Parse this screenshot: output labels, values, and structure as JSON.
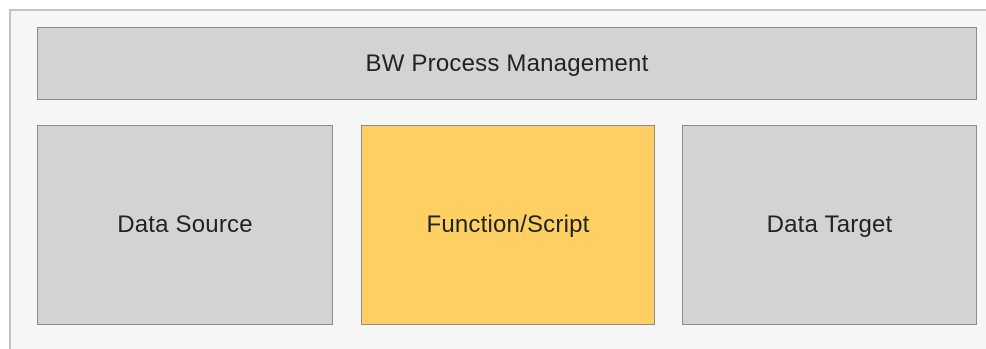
{
  "diagram": {
    "header": {
      "label": "BW Process Management"
    },
    "components": [
      {
        "label": "Data Source",
        "color": "#d3d3d3"
      },
      {
        "label": "Function/Script",
        "color": "#fed064"
      },
      {
        "label": "Data Target",
        "color": "#d3d3d3"
      }
    ],
    "colors": {
      "box": "#d3d3d3",
      "highlight": "#fed064",
      "border": "#8c8c8c",
      "frame": "#f6f6f6"
    }
  }
}
